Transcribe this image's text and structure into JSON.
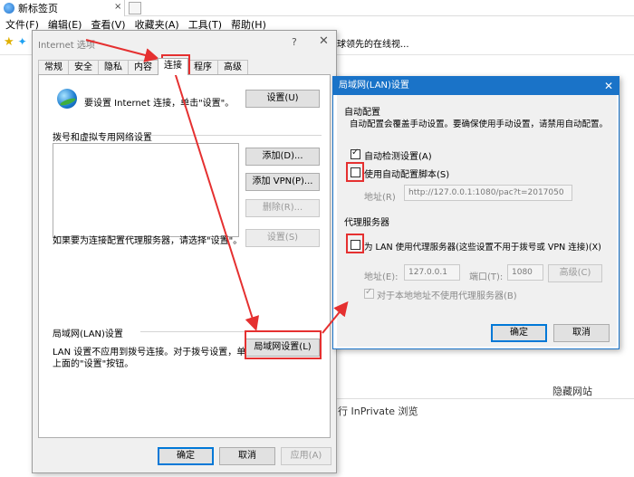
{
  "browser": {
    "tab_title": "新标签页",
    "tab_close": "×",
    "menu": [
      "文件(F)",
      "编辑(E)",
      "查看(V)",
      "收藏夹(A)",
      "工具(T)",
      "帮助(H)"
    ],
    "fav_text": "球领先的在线视...",
    "hidden_sites": "隐藏网站",
    "inprivate": "行 InPrivate 浏览"
  },
  "internet_options": {
    "title": "Internet 选项",
    "help": "?",
    "close": "✕",
    "tabs": [
      "常规",
      "安全",
      "隐私",
      "内容",
      "连接",
      "程序",
      "高级"
    ],
    "active_tab": "连接",
    "setup_text": "要设置 Internet 连接，单击\"设置\"。",
    "setup_button": "设置(U)",
    "dialup_heading": "拨号和虚拟专用网络设置",
    "add_button": "添加(D)...",
    "add_vpn_button": "添加 VPN(P)...",
    "remove_button": "删除(R)...",
    "proxy_hint": "如果要为连接配置代理服务器，请选择\"设置\"。",
    "settings_button": "设置(S)",
    "lan_heading": "局域网(LAN)设置",
    "lan_desc_line1": "LAN 设置不应用到拨号连接。对于拨号设置，单击",
    "lan_desc_line2": "上面的\"设置\"按钮。",
    "lan_button": "局域网设置(L)",
    "ok": "确定",
    "cancel": "取消",
    "apply": "应用(A)"
  },
  "lan_settings": {
    "title": "局域网(LAN)设置",
    "close": "✕",
    "auto_config_heading": "自动配置",
    "auto_config_desc": "自动配置会覆盖手动设置。要确保使用手动设置，请禁用自动配置。",
    "auto_detect_label": "自动检测设置(A)",
    "auto_detect_checked": true,
    "use_script_label": "使用自动配置脚本(S)",
    "use_script_checked": false,
    "address_label": "地址(R)",
    "script_address": "http://127.0.0.1:1080/pac?t=2017050",
    "proxy_heading": "代理服务器",
    "use_proxy_label": "为 LAN 使用代理服务器(这些设置不用于拨号或 VPN 连接)(X)",
    "use_proxy_checked": false,
    "proxy_address_label": "地址(E):",
    "proxy_address": "127.0.0.1",
    "port_label": "端口(T):",
    "port": "1080",
    "advanced_button": "高级(C)",
    "bypass_label": "对于本地地址不使用代理服务器(B)",
    "bypass_checked": true,
    "ok": "确定",
    "cancel": "取消"
  },
  "colors": {
    "arrow": "#e53030",
    "titlebar": "#1a73c8"
  }
}
